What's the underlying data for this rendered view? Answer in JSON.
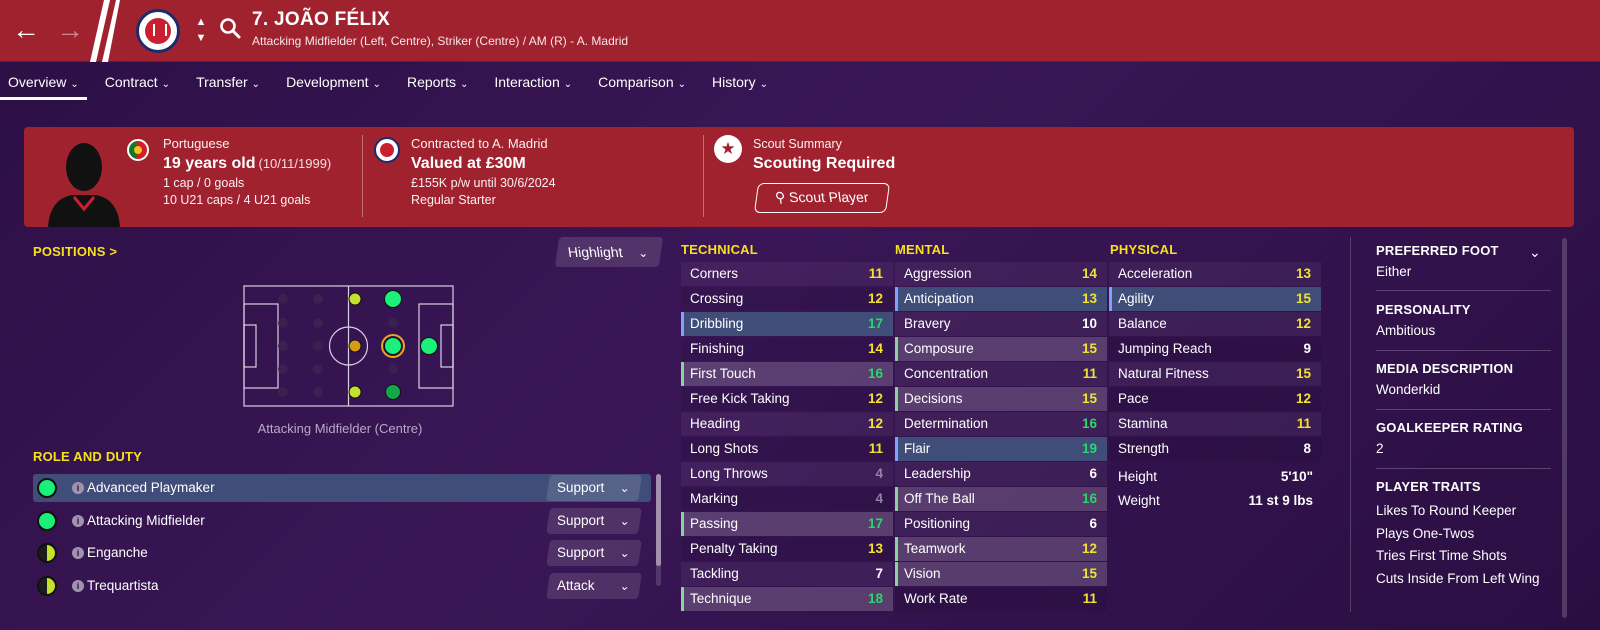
{
  "header": {
    "player_name": "7. JOÃO FÉLIX",
    "subtitle": "Attacking Midfielder (Left, Centre), Striker (Centre) / AM (R) - A. Madrid",
    "back_icon": "arrow-left-icon",
    "forward_icon": "arrow-right-icon",
    "search_icon": "search-icon",
    "updown": [
      "⌃",
      "⌄"
    ]
  },
  "tabs": [
    {
      "label": "Overview",
      "active": true
    },
    {
      "label": "Contract"
    },
    {
      "label": "Transfer"
    },
    {
      "label": "Development"
    },
    {
      "label": "Reports"
    },
    {
      "label": "Interaction"
    },
    {
      "label": "Comparison"
    },
    {
      "label": "History"
    }
  ],
  "summary": {
    "nationality": "Portuguese",
    "age": "19 years old",
    "dob": "(10/11/1999)",
    "caps": "1 cap / 0 goals",
    "u21": "10 U21 caps / 4 U21 goals",
    "contracted": "Contracted to A. Madrid",
    "value": "Valued at £30M",
    "wage": "£155K p/w until 30/6/2024",
    "squad_status": "Regular Starter",
    "scout_title": "Scout Summary",
    "scout_status": "Scouting Required",
    "scout_button": "Scout Player"
  },
  "positions": {
    "title": "POSITIONS >",
    "highlight_label": "Highlight",
    "caption": "Attacking Midfielder (Centre)"
  },
  "role": {
    "title": "ROLE AND DUTY",
    "rows": [
      {
        "name": "Advanced Playmaker",
        "duty": "Support",
        "suit": "full"
      },
      {
        "name": "Attacking Midfielder",
        "duty": "Support",
        "suit": "full"
      },
      {
        "name": "Enganche",
        "duty": "Support",
        "suit": "half"
      },
      {
        "name": "Trequartista",
        "duty": "Attack",
        "suit": "half"
      }
    ]
  },
  "technical": {
    "title": "TECHNICAL",
    "rows": [
      {
        "name": "Corners",
        "value": "11"
      },
      {
        "name": "Crossing",
        "value": "12"
      },
      {
        "name": "Dribbling",
        "value": "17"
      },
      {
        "name": "Finishing",
        "value": "14"
      },
      {
        "name": "First Touch",
        "value": "16"
      },
      {
        "name": "Free Kick Taking",
        "value": "12"
      },
      {
        "name": "Heading",
        "value": "12"
      },
      {
        "name": "Long Shots",
        "value": "11"
      },
      {
        "name": "Long Throws",
        "value": "4"
      },
      {
        "name": "Marking",
        "value": "4"
      },
      {
        "name": "Passing",
        "value": "17"
      },
      {
        "name": "Penalty Taking",
        "value": "13"
      },
      {
        "name": "Tackling",
        "value": "7"
      },
      {
        "name": "Technique",
        "value": "18"
      }
    ]
  },
  "mental": {
    "title": "MENTAL",
    "rows": [
      {
        "name": "Aggression",
        "value": "14"
      },
      {
        "name": "Anticipation",
        "value": "13"
      },
      {
        "name": "Bravery",
        "value": "10"
      },
      {
        "name": "Composure",
        "value": "15"
      },
      {
        "name": "Concentration",
        "value": "11"
      },
      {
        "name": "Decisions",
        "value": "15"
      },
      {
        "name": "Determination",
        "value": "16"
      },
      {
        "name": "Flair",
        "value": "19"
      },
      {
        "name": "Leadership",
        "value": "6"
      },
      {
        "name": "Off The Ball",
        "value": "16"
      },
      {
        "name": "Positioning",
        "value": "6"
      },
      {
        "name": "Teamwork",
        "value": "12"
      },
      {
        "name": "Vision",
        "value": "15"
      },
      {
        "name": "Work Rate",
        "value": "11"
      }
    ]
  },
  "physical": {
    "title": "PHYSICAL",
    "rows": [
      {
        "name": "Acceleration",
        "value": "13"
      },
      {
        "name": "Agility",
        "value": "15"
      },
      {
        "name": "Balance",
        "value": "12"
      },
      {
        "name": "Jumping Reach",
        "value": "9"
      },
      {
        "name": "Natural Fitness",
        "value": "15"
      },
      {
        "name": "Pace",
        "value": "12"
      },
      {
        "name": "Stamina",
        "value": "11"
      },
      {
        "name": "Strength",
        "value": "8"
      }
    ],
    "height_label": "Height",
    "height": "5'10\"",
    "weight_label": "Weight",
    "weight": "11 st 9 lbs"
  },
  "info": {
    "foot_label": "PREFERRED FOOT",
    "foot": "Either",
    "personality_label": "PERSONALITY",
    "personality": "Ambitious",
    "media_label": "MEDIA DESCRIPTION",
    "media": "Wonderkid",
    "gk_label": "GOALKEEPER RATING",
    "gk": "2",
    "traits_label": "PLAYER TRAITS",
    "traits": [
      "Likes To Round Keeper",
      "Plays One-Twos",
      "Tries First Time Shots",
      "Cuts Inside From Left Wing"
    ]
  },
  "colors": {
    "header_red": "#a1222f",
    "attr_yellow": "#f3e32f",
    "attr_green": "#28d86a",
    "section_yellow": "#f6e11c"
  }
}
